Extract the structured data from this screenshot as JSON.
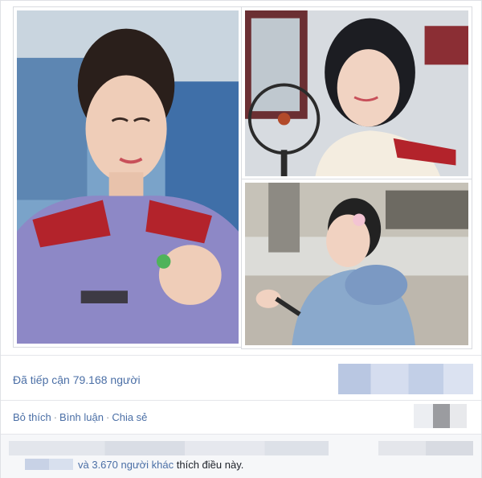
{
  "photos": [
    {
      "name": "photo-left",
      "theme": "officer-purple-uniform"
    },
    {
      "name": "photo-top-right",
      "theme": "officer-beige-uniform"
    },
    {
      "name": "photo-bottom-right",
      "theme": "blue-coat-outdoor"
    }
  ],
  "reach": {
    "text": "Đã tiếp cận 79.168 người"
  },
  "actions": {
    "like": "Bỏ thích",
    "sep1": "·",
    "comment": "Bình luận",
    "sep2": "·",
    "share": "Chia sẻ"
  },
  "likes": {
    "count_text": "và 3.670 người khác",
    "suffix": "thích điều này."
  },
  "colors": {
    "link": "#4b6fa6",
    "text": "#1d2129",
    "border": "#e5e6ea"
  }
}
